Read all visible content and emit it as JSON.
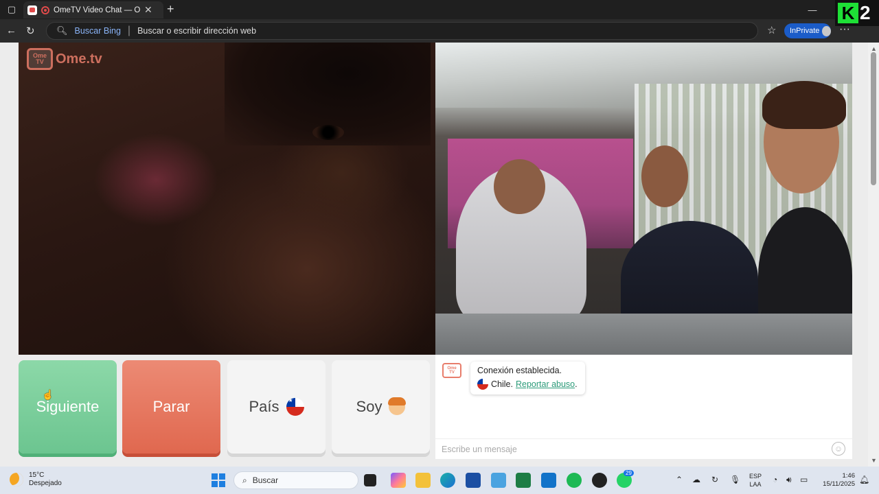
{
  "browser": {
    "tab_title": "OmeTV Video Chat — Omeg",
    "search_engine_label": "Buscar Bing",
    "address_placeholder": "Buscar o escribir dirección web",
    "inprivate_label": "InPrivate"
  },
  "overlay": {
    "channel_k": "K",
    "channel_num": "2"
  },
  "logo": {
    "tv_line1": "Ome",
    "tv_line2": "TV",
    "name": "Ome.tv"
  },
  "buttons": {
    "next": "Siguiente",
    "stop": "Parar",
    "country": "País",
    "gender": "Soy"
  },
  "chat": {
    "logo_line1": "Ome",
    "logo_line2": "TV",
    "status": "Conexión establecida.",
    "country": "Chile.",
    "report_link": "Reportar abuso",
    "report_suffix": ".",
    "input_placeholder": "Escribe un mensaje"
  },
  "taskbar": {
    "temperature": "15°C",
    "weather": "Despejado",
    "search_placeholder": "Buscar",
    "whatsapp_badge": "29",
    "lang_line1": "ESP",
    "lang_line2": "LAA",
    "time": "1:46",
    "date": "15/11/2025"
  },
  "colors": {
    "next_button": "#6cc590",
    "stop_button": "#e0684f",
    "brand": "#e87d6b",
    "link": "#2a9a78"
  }
}
